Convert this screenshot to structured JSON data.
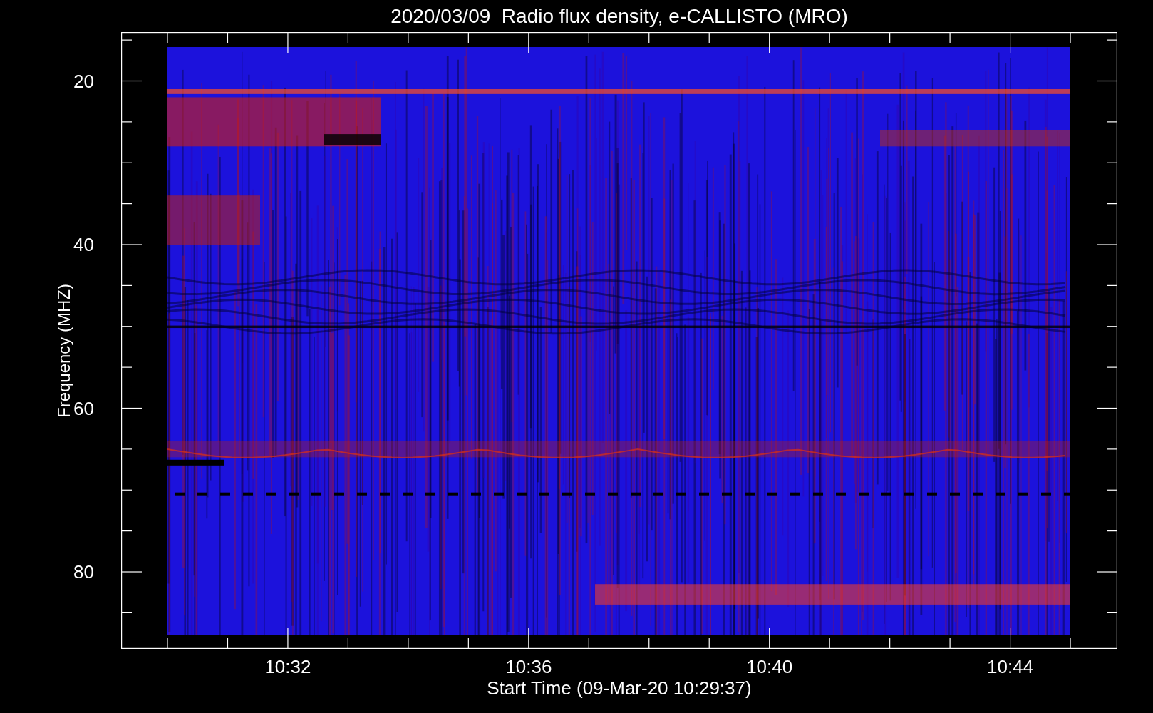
{
  "title": "2020/03/09  Radio flux density, e-CALLISTO (MRO)",
  "y_axis": {
    "label": "Frequency (MHZ)",
    "ticks": [
      "20",
      "40",
      "60",
      "80"
    ]
  },
  "x_axis": {
    "label": "Start Time (09-Mar-20 10:29:37)",
    "ticks": [
      "10:32",
      "10:36",
      "10:40",
      "10:44"
    ]
  }
}
